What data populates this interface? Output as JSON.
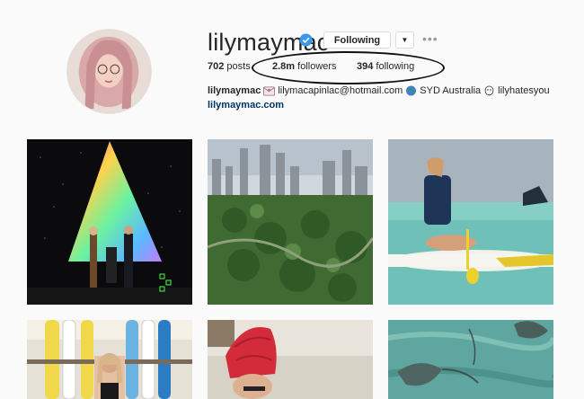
{
  "profile": {
    "username": "lilymaymac",
    "verified": true,
    "follow_button": "Following",
    "dropdown_icon": "chevron-down-icon",
    "more_icon": "ellipsis-icon",
    "more_label": "•••"
  },
  "stats": {
    "posts_count": "702",
    "posts_label": "posts",
    "followers_count": "2.8m",
    "followers_label": "followers",
    "following_count": "394",
    "following_label": "following"
  },
  "bio": {
    "name": "lilymaymac",
    "email": "lilymacapinlac@hotmail.com",
    "location": "SYD Australia",
    "handle": "lilyhatesyou",
    "website": "lilymaymac.com"
  },
  "colors": {
    "background": "#fafafa",
    "link": "#003569",
    "verified": "#3897f0",
    "annotation": "#111111"
  },
  "posts": [
    {
      "subject": "stage-triangle-performance"
    },
    {
      "subject": "city-skyline-park"
    },
    {
      "subject": "paddleboard-ocean"
    },
    {
      "subject": "surfboards-rack"
    },
    {
      "subject": "red-turban-beach"
    },
    {
      "subject": "stingrays-water"
    }
  ]
}
